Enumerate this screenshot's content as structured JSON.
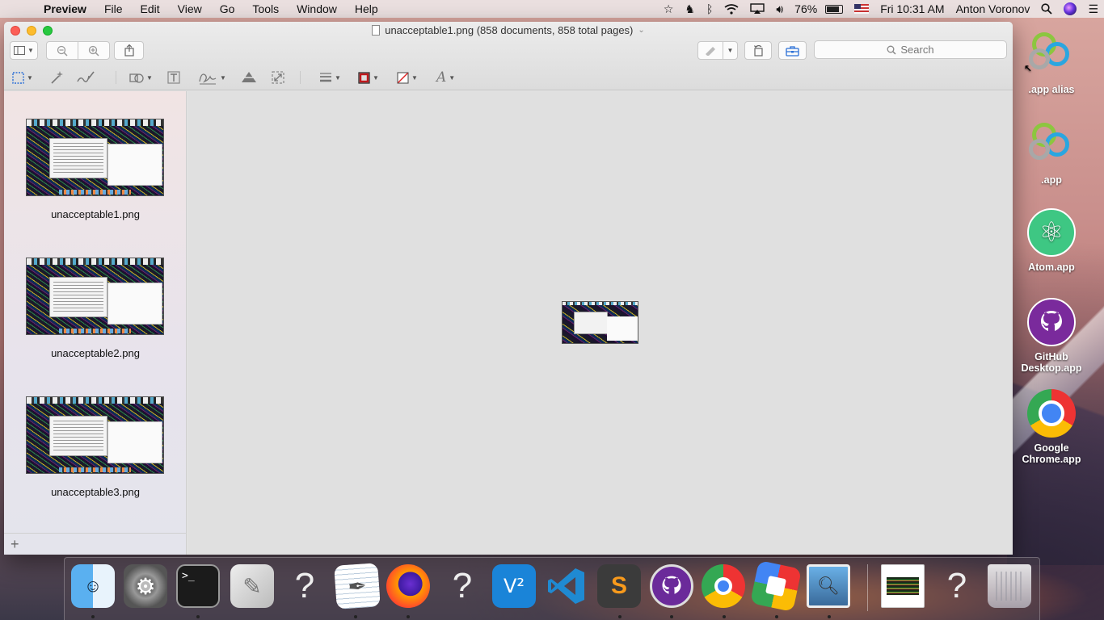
{
  "menubar": {
    "app_name": "Preview",
    "menus": [
      "File",
      "Edit",
      "View",
      "Go",
      "Tools",
      "Window",
      "Help"
    ],
    "battery_percent": "76%",
    "clock": "Fri 10:31 AM",
    "user": "Anton Voronov",
    "icons": [
      "apple-icon",
      "star-icon",
      "evernote-icon",
      "bluetooth-icon",
      "wifi-icon",
      "airplay-icon",
      "volume-icon",
      "battery-icon",
      "us-flag-icon",
      "spotlight-icon",
      "siri-icon",
      "notification-center-icon"
    ]
  },
  "window": {
    "title": "unacceptable1.png (858 documents, 858 total pages)",
    "search_placeholder": "Search"
  },
  "sidebar": {
    "thumbnails": [
      {
        "label": "unacceptable1.png"
      },
      {
        "label": "unacceptable2.png"
      },
      {
        "label": "unacceptable3.png"
      }
    ],
    "add_label": "+"
  },
  "desktop": {
    "icons": [
      {
        "label": ".app alias",
        "icon": "app-alias-rings-icon"
      },
      {
        "label": ".app",
        "icon": "app-rings-icon"
      },
      {
        "label": "Atom.app",
        "icon": "atom-icon"
      },
      {
        "label": "GitHub Desktop.app",
        "icon": "github-icon"
      },
      {
        "label": "Google Chrome.app",
        "icon": "chrome-icon"
      }
    ]
  },
  "dock": {
    "items": [
      "finder",
      "system-preferences",
      "terminal",
      "script-editor",
      "unknown-app",
      "textedit",
      "firefox",
      "unknown-app",
      "vnc-viewer",
      "visual-studio-code",
      "sublime-text",
      "github-desktop",
      "google-chrome",
      "cloud-app",
      "preview",
      "document-file",
      "unknown-app",
      "trash"
    ],
    "colors": {
      "accent": "#2b6fd6"
    }
  }
}
